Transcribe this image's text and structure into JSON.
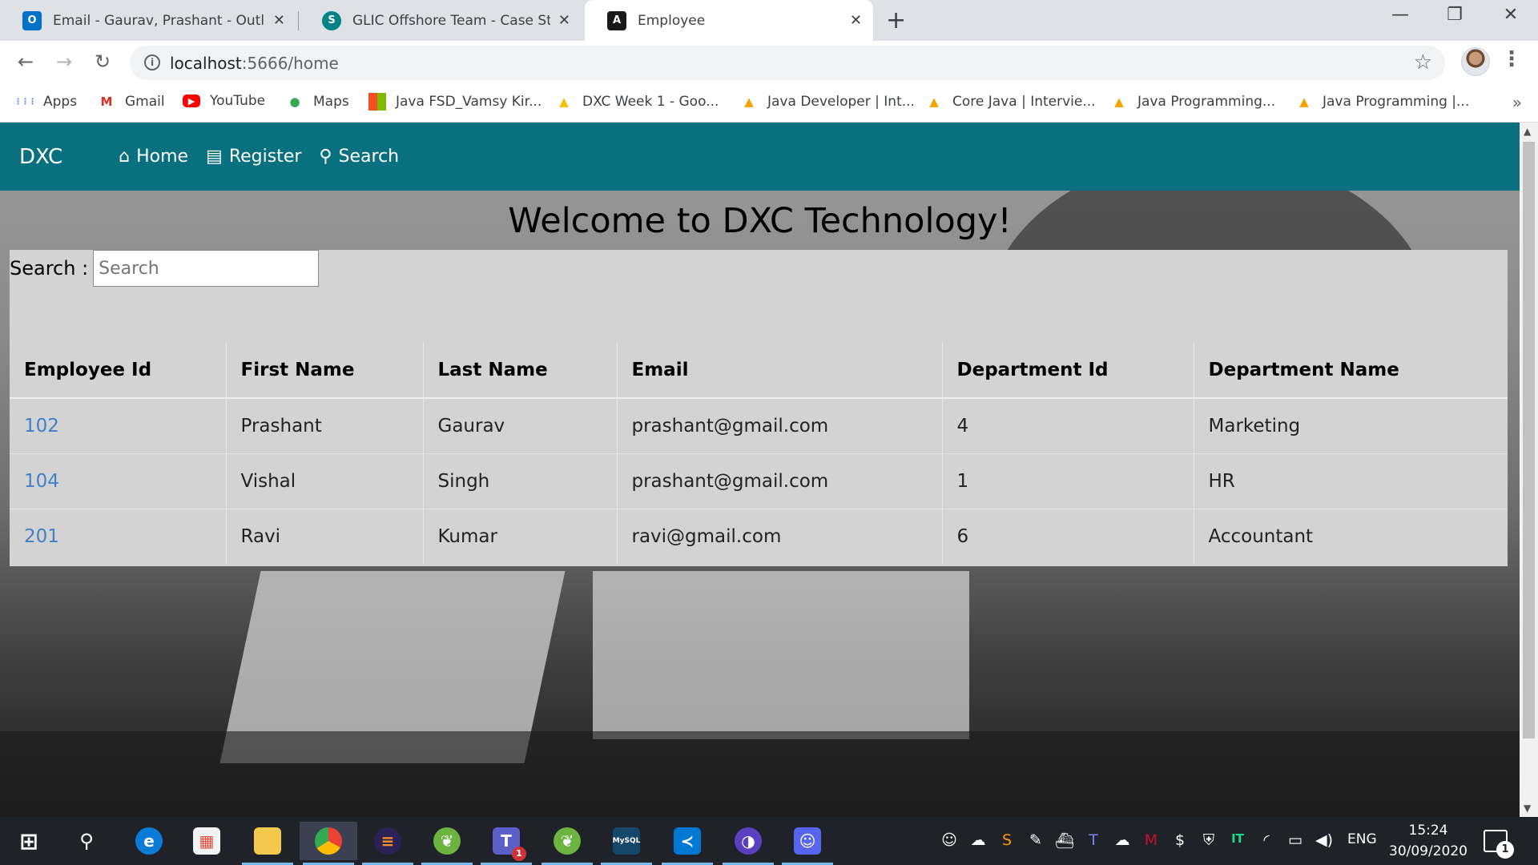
{
  "browser": {
    "tabs": [
      {
        "title": "Email - Gaurav, Prashant - Outlook",
        "close": "✕",
        "icon": "outlook-icon"
      },
      {
        "title": "GLIC Offshore Team - Case Study",
        "close": "✕",
        "icon": "sharepoint-icon"
      },
      {
        "title": "Employee",
        "close": "✕",
        "icon": "angular-icon"
      }
    ],
    "new_tab": "+",
    "window_controls": {
      "minimize": "—",
      "restore": "❐",
      "close": "✕"
    },
    "nav": {
      "back": "←",
      "forward": "→",
      "reload": "↻"
    },
    "url_host": "localhost",
    "url_path": ":5666/home",
    "info_icon": "i",
    "star": "☆",
    "menu": "⋮",
    "bookmarks": [
      {
        "label": "Apps",
        "icon": "apps-grid-icon",
        "glyph": "⋮⋮⋮",
        "color": "#4285f4"
      },
      {
        "label": "Gmail",
        "icon": "gmail-icon",
        "glyph": "M",
        "color": "#d93025"
      },
      {
        "label": "YouTube",
        "icon": "youtube-icon",
        "glyph": "▶",
        "color": "#ff0000"
      },
      {
        "label": "Maps",
        "icon": "maps-pin-icon",
        "glyph": "📍",
        "color": "#34a853"
      },
      {
        "label": "Java FSD_Vamsy Kir...",
        "icon": "microsoft-icon",
        "glyph": "▦",
        "color": "#f25022"
      },
      {
        "label": "DXC Week 1 - Goo...",
        "icon": "google-drive-icon",
        "glyph": "▲",
        "color": "#fbbc04"
      },
      {
        "label": "Java Developer | Int...",
        "icon": "graduation-cap-icon",
        "glyph": "🎓",
        "color": "#f4a300"
      },
      {
        "label": "Core Java | Intervie...",
        "icon": "graduation-cap-icon",
        "glyph": "🎓",
        "color": "#f4a300"
      },
      {
        "label": "Java Programming...",
        "icon": "graduation-cap-icon",
        "glyph": "🎓",
        "color": "#f4a300"
      },
      {
        "label": "Java Programming |...",
        "icon": "graduation-cap-icon",
        "glyph": "🎓",
        "color": "#f4a300"
      }
    ],
    "bookmarks_more": "»"
  },
  "app": {
    "brand": "DXC",
    "nav": [
      {
        "label": "Home",
        "icon": "home-icon",
        "glyph": "⌂"
      },
      {
        "label": "Register",
        "icon": "register-icon",
        "glyph": "▤"
      },
      {
        "label": "Search",
        "icon": "search-icon",
        "glyph": "⚲"
      }
    ],
    "welcome": "Welcome to DXC Technology!",
    "search_label": "Search :",
    "search_placeholder": "Search",
    "search_value": "",
    "table": {
      "headers": [
        "Employee Id",
        "First Name",
        "Last Name",
        "Email",
        "Department Id",
        "Department Name"
      ],
      "rows": [
        [
          "102",
          "Prashant",
          "Gaurav",
          "prashant@gmail.com",
          "4",
          "Marketing"
        ],
        [
          "104",
          "Vishal",
          "Singh",
          "prashant@gmail.com",
          "1",
          "HR"
        ],
        [
          "201",
          "Ravi",
          "Kumar",
          "ravi@gmail.com",
          "6",
          "Accountant"
        ]
      ]
    },
    "colors": {
      "navbar": "#08707f",
      "link": "#3f80c8",
      "panel": "#d3d3d3"
    }
  },
  "taskbar": {
    "apps": [
      {
        "icon": "windows-start-icon",
        "glyph": "⊞",
        "color": "transparent"
      },
      {
        "icon": "search-icon",
        "glyph": "⚲",
        "color": "transparent"
      },
      {
        "icon": "edge-icon",
        "glyph": "e",
        "color": "#0a7cd8"
      },
      {
        "icon": "store-icon",
        "glyph": "🛍",
        "color": "transparent"
      },
      {
        "icon": "file-explorer-icon",
        "glyph": "▬",
        "color": "#f2c94c"
      },
      {
        "icon": "chrome-icon",
        "glyph": "◉",
        "color": "#34a853"
      },
      {
        "icon": "eclipse-icon",
        "glyph": "◐",
        "color": "#2c2255"
      },
      {
        "icon": "spring-tools-icon",
        "glyph": "❦",
        "color": "#6db33f"
      },
      {
        "icon": "teams-icon",
        "glyph": "T",
        "color": "#5b5fc7"
      },
      {
        "icon": "spring-tools-icon",
        "glyph": "❦",
        "color": "#6db33f"
      },
      {
        "icon": "mysql-workbench-icon",
        "glyph": "▭",
        "color": "#15476b"
      },
      {
        "icon": "vscode-icon",
        "glyph": "≺",
        "color": "#0078d4"
      },
      {
        "icon": "eclipse-ide-icon",
        "glyph": "◑",
        "color": "#5a3fc0"
      },
      {
        "icon": "discord-icon",
        "glyph": "☺",
        "color": "#5865f2"
      }
    ],
    "teams_badge": "1",
    "tray": [
      {
        "icon": "discord-tray-icon",
        "glyph": "☺"
      },
      {
        "icon": "cloud-tray-icon",
        "glyph": "☁"
      },
      {
        "icon": "sublime-tray-icon",
        "glyph": "S"
      },
      {
        "icon": "notepad-tray-icon",
        "glyph": "✎"
      },
      {
        "icon": "docker-tray-icon",
        "glyph": "⛴"
      },
      {
        "icon": "teams-tray-icon",
        "glyph": "T"
      },
      {
        "icon": "onedrive-tray-icon",
        "glyph": "☁"
      },
      {
        "icon": "mcafee-tray-icon",
        "glyph": "M"
      },
      {
        "icon": "dollar-tray-icon",
        "glyph": "$"
      },
      {
        "icon": "defender-tray-icon",
        "glyph": "⛨"
      },
      {
        "icon": "intellij-tray-icon",
        "glyph": "IT"
      },
      {
        "icon": "wifi-icon",
        "glyph": "◜"
      },
      {
        "icon": "battery-icon",
        "glyph": "▭"
      },
      {
        "icon": "volume-icon",
        "glyph": "🔊"
      }
    ],
    "language": "ENG",
    "time": "15:24",
    "date": "30/09/2020",
    "notifications": "1"
  }
}
